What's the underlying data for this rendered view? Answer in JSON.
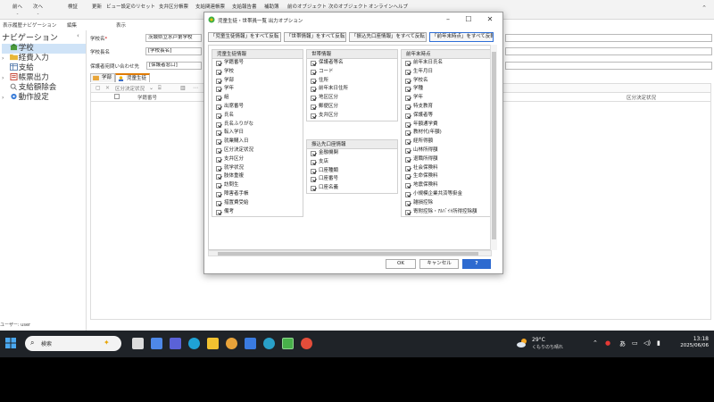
{
  "toolbar": {
    "items": [
      "前へ",
      "次へ",
      "検証",
      "更新",
      "ビュー設定のリセット",
      "支弁区分帳票",
      "支給関連帳票",
      "支給報告書",
      "補助簿",
      "前のオブジェクト",
      "次のオブジェクト",
      "オンラインヘルプ"
    ]
  },
  "subhead": {
    "history": "表示履歴ナビゲーション",
    "edit": "編集",
    "display": "表示"
  },
  "nav": {
    "title": "ナビゲーション",
    "items": [
      "学校",
      "経費入力",
      "支給",
      "帳票出力",
      "支給額除会",
      "動作設定"
    ],
    "status_user": "ユーザー: user"
  },
  "form": {
    "school_name_label": "学校名",
    "school_name_value": "茨城県立水戸第学校",
    "school_type_label": "学校長名",
    "school_type_value": "[学校長名]",
    "guardian_label": "保護者宛問い合わせ先",
    "guardian_value": "[保護者窓口]",
    "tabs": [
      "学部",
      "児童生徒"
    ],
    "grid_toolbar": "区分決定状況",
    "grid_headers": [
      "学籍番号",
      "区分決定状況"
    ]
  },
  "dialog": {
    "title": "児童生徒・世帯員一覧 出力オプション",
    "top_buttons": [
      "「児童生徒情報」をすべて反転",
      "「世帯情報」をすべて反転",
      "「振込先口座情報」をすべて反転",
      "「前年末時点」をすべて反転"
    ],
    "groups": {
      "student": {
        "header": "児童生徒情報",
        "items": [
          "学籍番号",
          "学校",
          "学部",
          "学年",
          "組",
          "出席番号",
          "氏名",
          "氏名ふりがな",
          "転入学日",
          "就業購入日",
          "区分決定状況",
          "支弁区分",
          "就学状況",
          "肢体重複",
          "訪問生",
          "障害者手帳",
          "措置費受給",
          "備考"
        ]
      },
      "household": {
        "header": "世帯情報",
        "items": [
          "保護者等名",
          "コード",
          "住所",
          "前年末日住所",
          "地区区分",
          "郵便区分",
          "支弁区分"
        ]
      },
      "bank": {
        "header": "振込先口座情報",
        "items": [
          "金融機関",
          "支店",
          "口座種類",
          "口座番号",
          "口座名義"
        ]
      },
      "prev_year": {
        "header": "前年末時点",
        "items": [
          "前年末日氏名",
          "生年月日",
          "学校名",
          "学種",
          "学年",
          "特支教育",
          "保護者等",
          "年額通学費",
          "教材代(年額)",
          "経所得額",
          "山林所得額",
          "退職所得額",
          "社会保険料",
          "生命保険料",
          "地震保険料",
          "小規模企業共済等掛金",
          "雑損控除",
          "寄附控除・ｱﾙﾊﾞｲﾄ所得控除額"
        ]
      }
    },
    "ok": "OK",
    "cancel": "キャンセル",
    "help": "?"
  },
  "taskbar": {
    "search_placeholder": "検索",
    "weather_temp": "29°C",
    "weather_desc": "くもりのち晴れ",
    "tray_ime": "あ",
    "time": "13:18",
    "date": "2025/06/06"
  }
}
